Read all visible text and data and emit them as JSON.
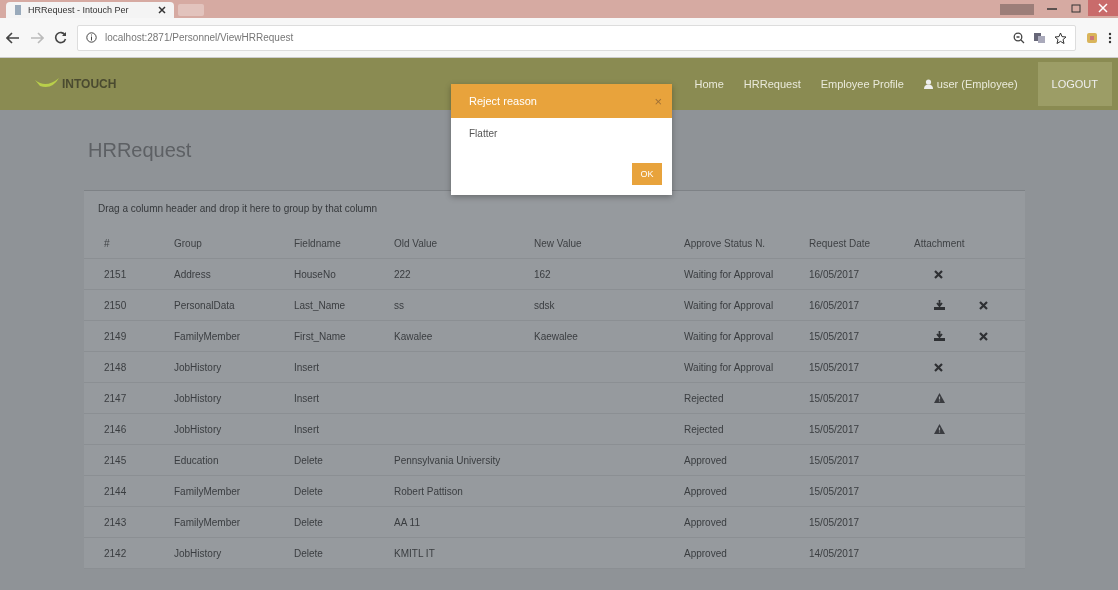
{
  "browser": {
    "tab_title": "HRRequest - Intouch Per",
    "address": "localhost:2871/Personnel/ViewHRRequest"
  },
  "navbar": {
    "logo": "INTOUCH",
    "links": [
      "Home",
      "HRRequest",
      "Employee Profile"
    ],
    "user": "user (Employee)",
    "logout": "LOGOUT"
  },
  "page": {
    "title": "HRRequest",
    "group_hint": "Drag a column header and drop it here to group by that column"
  },
  "table": {
    "columns": [
      "#",
      "Group",
      "Fieldname",
      "Old Value",
      "New Value",
      "Approve Status N.",
      "Request Date",
      "Attachment"
    ],
    "rows": [
      {
        "cells": [
          "2151",
          "Address",
          "HouseNo",
          "222",
          "162",
          "Waiting for Approval",
          "16/05/2017"
        ],
        "attachments": [
          {
            "kind": "remove"
          }
        ]
      },
      {
        "cells": [
          "2150",
          "PersonalData",
          "Last_Name",
          "ss",
          "sdsk",
          "Waiting for Approval",
          "16/05/2017"
        ],
        "attachments": [
          {
            "kind": "download"
          },
          {
            "kind": "remove"
          }
        ]
      },
      {
        "cells": [
          "2149",
          "FamilyMember",
          "First_Name",
          "Kawalee",
          "Kaewalee",
          "Waiting for Approval",
          "15/05/2017"
        ],
        "attachments": [
          {
            "kind": "download"
          },
          {
            "kind": "remove"
          }
        ]
      },
      {
        "cells": [
          "2148",
          "JobHistory",
          "Insert",
          "",
          "",
          "Waiting for Approval",
          "15/05/2017"
        ],
        "attachments": [
          {
            "kind": "remove"
          }
        ]
      },
      {
        "cells": [
          "2147",
          "JobHistory",
          "Insert",
          "",
          "",
          "Rejected",
          "15/05/2017"
        ],
        "attachments": [
          {
            "kind": "warning"
          }
        ]
      },
      {
        "cells": [
          "2146",
          "JobHistory",
          "Insert",
          "",
          "",
          "Rejected",
          "15/05/2017"
        ],
        "attachments": [
          {
            "kind": "warning"
          }
        ]
      },
      {
        "cells": [
          "2145",
          "Education",
          "Delete",
          "Pennsylvania University",
          "",
          "Approved",
          "15/05/2017"
        ],
        "attachments": []
      },
      {
        "cells": [
          "2144",
          "FamilyMember",
          "Delete",
          "Robert Pattison",
          "",
          "Approved",
          "15/05/2017"
        ],
        "attachments": []
      },
      {
        "cells": [
          "2143",
          "FamilyMember",
          "Delete",
          "AA 11",
          "",
          "Approved",
          "15/05/2017"
        ],
        "attachments": []
      },
      {
        "cells": [
          "2142",
          "JobHistory",
          "Delete",
          "KMITL IT",
          "",
          "Approved",
          "14/05/2017"
        ],
        "attachments": []
      }
    ]
  },
  "dialog": {
    "title": "Reject reason",
    "close": "×",
    "message": "Flatter",
    "ok": "OK"
  }
}
